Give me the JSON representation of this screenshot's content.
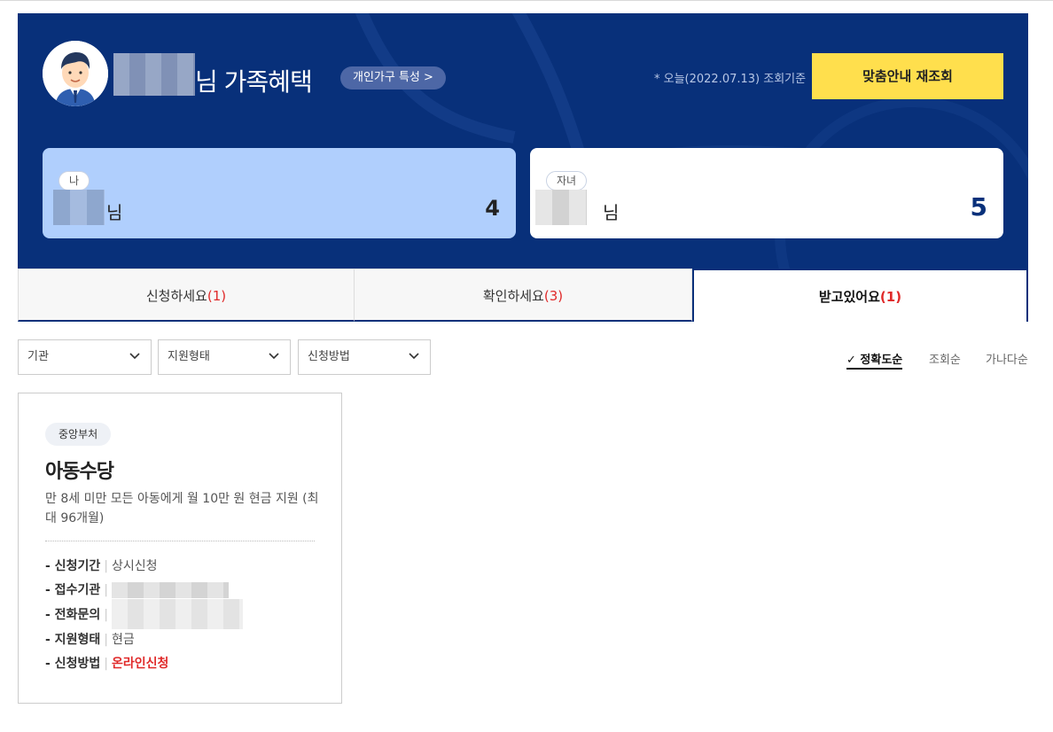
{
  "header": {
    "title_suffix": "님 가족혜택",
    "trait_button": "개인가구 특성 >",
    "query_date": "* 오늘(2022.07.13) 조회기준",
    "requery_button": "맞춤안내 재조회"
  },
  "members": [
    {
      "tag": "나",
      "suffix": "님",
      "count": "4"
    },
    {
      "tag": "자녀",
      "suffix": "님",
      "count": "5"
    }
  ],
  "tabs": [
    {
      "label": "신청하세요",
      "count": "(1)"
    },
    {
      "label": "확인하세요",
      "count": "(3)"
    },
    {
      "label": "받고있어요",
      "count": "(1)"
    }
  ],
  "filters": [
    "기관",
    "지원형태",
    "신청방법"
  ],
  "sort": {
    "selected": "✓ 정확도순",
    "options": [
      "조회순",
      "가나다순"
    ]
  },
  "benefit_card": {
    "agency": "중앙부처",
    "title": "아동수당",
    "description": "만 8세 미만 모든 아동에게 월 10만 원 현금 지원 (최대 96개월)",
    "rows": [
      {
        "key": "- 신청기간",
        "value": "상시신청"
      },
      {
        "key": "- 접수기관",
        "value": ""
      },
      {
        "key": "- 전화문의",
        "value": ""
      },
      {
        "key": "- 지원형태",
        "value": "현금"
      },
      {
        "key": "- 신청방법",
        "value": "온라인신청"
      }
    ]
  },
  "colors": {
    "navy": "#08307a",
    "accent_yellow": "#ffdf4d",
    "alert_red": "#e02a2a"
  }
}
